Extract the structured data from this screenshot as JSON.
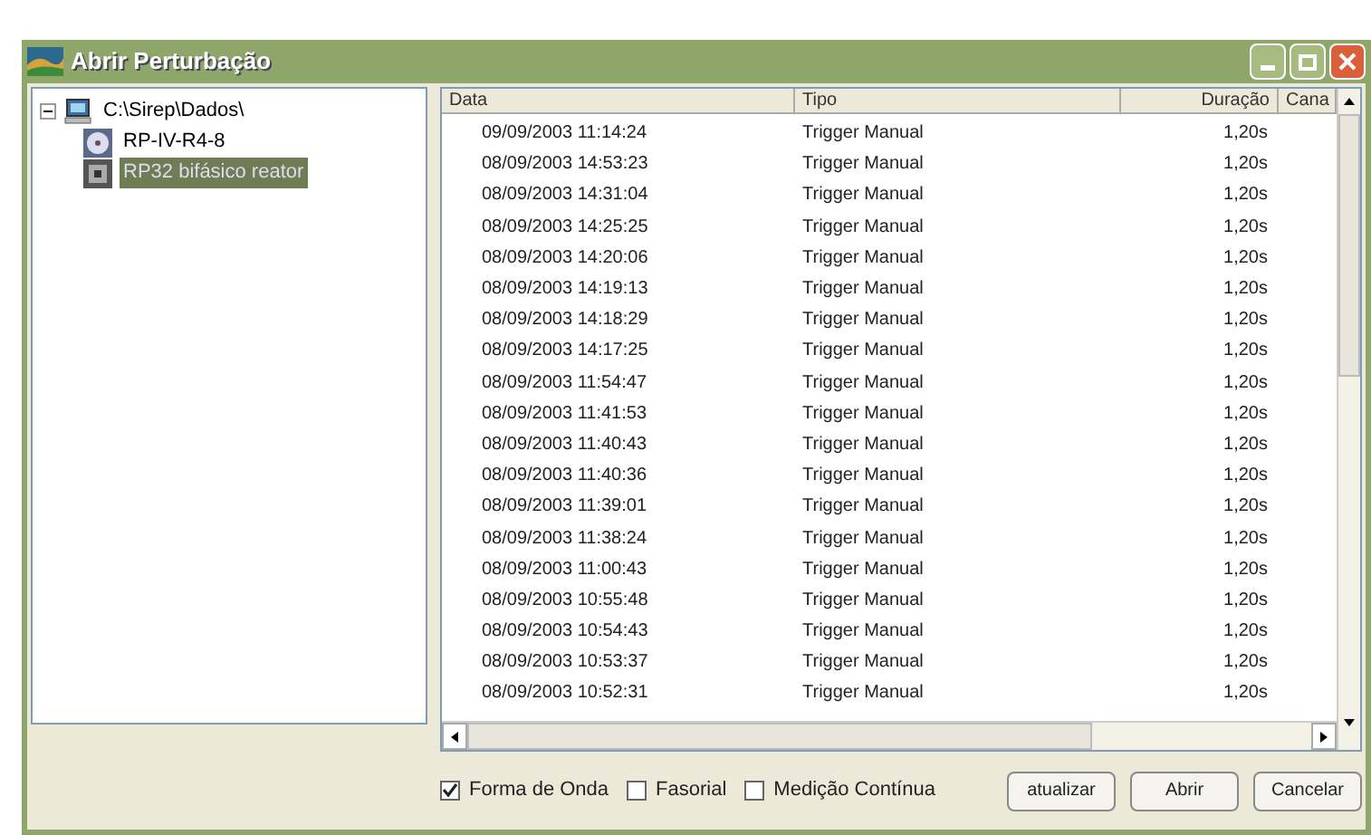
{
  "window": {
    "title": "Abrir Perturbação"
  },
  "tree": [
    {
      "label": "C:\\Sirep\\Dados\\",
      "expanded": true,
      "selected": false,
      "children": [
        {
          "label": "RP-IV-R4-8",
          "selected": false
        },
        {
          "label": "RP32 bifásico reator",
          "selected": true
        }
      ]
    }
  ],
  "table": {
    "columns": [
      "Data",
      "Tipo",
      "Duração",
      "Cana"
    ],
    "rows": [
      [
        "09/09/2003 11:14:24",
        "Trigger Manual",
        "1,20s"
      ],
      [
        "08/09/2003 14:53:23",
        "Trigger Manual",
        "1,20s"
      ],
      [
        "08/09/2003 14:31:04",
        "Trigger Manual",
        "1,20s"
      ],
      [
        "08/09/2003 14:25:25",
        "Trigger Manual",
        "1,20s"
      ],
      [
        "08/09/2003 14:20:06",
        "Trigger Manual",
        "1,20s"
      ],
      [
        "08/09/2003 14:19:13",
        "Trigger Manual",
        "1,20s"
      ],
      [
        "08/09/2003 14:18:29",
        "Trigger Manual",
        "1,20s"
      ],
      [
        "08/09/2003 14:17:25",
        "Trigger Manual",
        "1,20s"
      ],
      [
        "08/09/2003 11:54:47",
        "Trigger Manual",
        "1,20s"
      ],
      [
        "08/09/2003 11:41:53",
        "Trigger Manual",
        "1,20s"
      ],
      [
        "08/09/2003 11:40:43",
        "Trigger Manual",
        "1,20s"
      ],
      [
        "08/09/2003 11:40:36",
        "Trigger Manual",
        "1,20s"
      ],
      [
        "08/09/2003 11:39:01",
        "Trigger Manual",
        "1,20s"
      ],
      [
        "08/09/2003 11:38:24",
        "Trigger Manual",
        "1,20s"
      ],
      [
        "08/09/2003 11:00:43",
        "Trigger Manual",
        "1,20s"
      ],
      [
        "08/09/2003 10:55:48",
        "Trigger Manual",
        "1,20s"
      ],
      [
        "08/09/2003 10:54:43",
        "Trigger Manual",
        "1,20s"
      ],
      [
        "08/09/2003 10:53:37",
        "Trigger Manual",
        "1,20s"
      ],
      [
        "08/09/2003 10:52:31",
        "Trigger Manual",
        "1,20s"
      ]
    ]
  },
  "options": [
    {
      "label": "Forma de Onda",
      "checked": true
    },
    {
      "label": "Fasorial",
      "checked": false
    },
    {
      "label": "Medição Contínua",
      "checked": false
    }
  ],
  "buttons": [
    "atualizar",
    "Abrir",
    "Cancelar"
  ]
}
